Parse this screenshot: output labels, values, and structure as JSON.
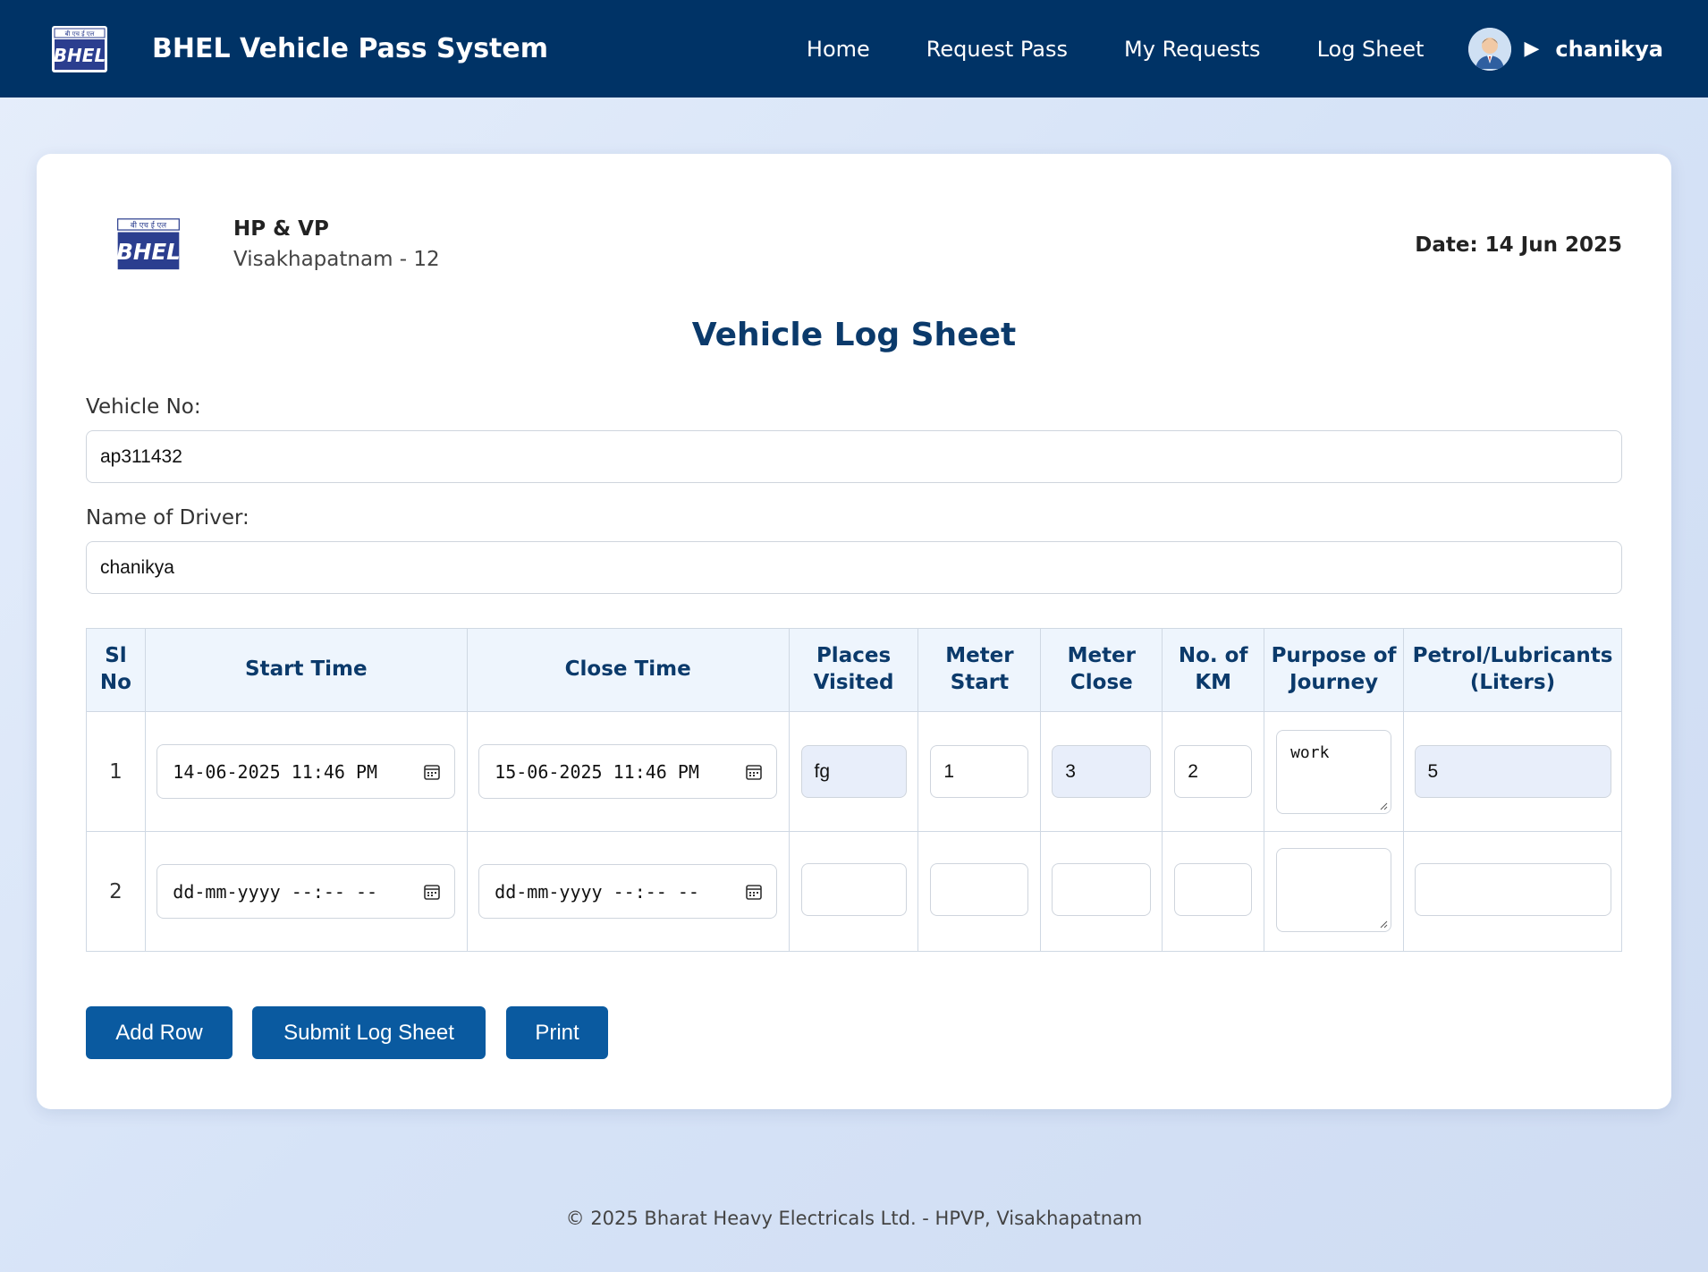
{
  "nav": {
    "title": "BHEL Vehicle Pass System",
    "logo_text_top": "बी एच ई एल",
    "logo_text": "BHEL",
    "links": [
      "Home",
      "Request Pass",
      "My Requests",
      "Log Sheet"
    ],
    "username": "chanikya",
    "bg_color": "#003366"
  },
  "header": {
    "org_name": "HP & VP",
    "location": "Visakhapatnam - 12",
    "date": "Date: 14 Jun 2025",
    "title": "Vehicle Log Sheet"
  },
  "form": {
    "vehicle_label": "Vehicle No:",
    "vehicle_value": "ap311432",
    "driver_label": "Name of Driver:",
    "driver_value": "chanikya"
  },
  "table": {
    "headers": {
      "sl_no": "Sl No",
      "start_time": "Start Time",
      "close_time": "Close Time",
      "places": "Places Visited",
      "meter_start": "Meter Start",
      "meter_close": "Meter Close",
      "km": "No. of KM",
      "purpose": "Purpose of Journey",
      "petrol": "Petrol/Lubricants (Liters)"
    },
    "rows": [
      {
        "sl": "1",
        "start": "14-06-2025 11:46 PM",
        "close": "15-06-2025 11:46 PM",
        "places": "fg",
        "meter_start": "1",
        "meter_close": "3",
        "km": "2",
        "purpose": "work",
        "petrol": "5"
      },
      {
        "sl": "2",
        "start": "dd-mm-yyyy --:-- --",
        "close": "dd-mm-yyyy --:-- --",
        "places": "",
        "meter_start": "",
        "meter_close": "",
        "km": "",
        "purpose": "",
        "petrol": ""
      }
    ]
  },
  "buttons": {
    "add_row": "Add Row",
    "submit": "Submit Log Sheet",
    "print": "Print"
  },
  "footer": "© 2025 Bharat Heavy Electricals Ltd. - HPVP, Visakhapatnam"
}
